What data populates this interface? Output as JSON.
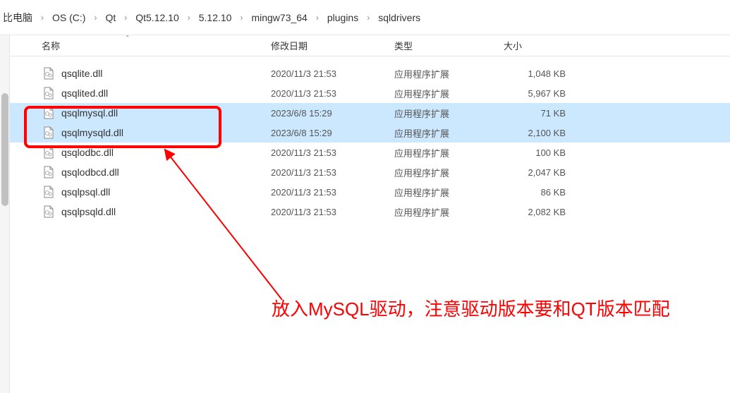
{
  "breadcrumb": {
    "items": [
      {
        "label": "比电脑"
      },
      {
        "label": "OS (C:)"
      },
      {
        "label": "Qt"
      },
      {
        "label": "Qt5.12.10"
      },
      {
        "label": "5.12.10"
      },
      {
        "label": "mingw73_64"
      },
      {
        "label": "plugins"
      },
      {
        "label": "sqldrivers"
      }
    ],
    "separator": "›"
  },
  "columns": {
    "name": "名称",
    "date": "修改日期",
    "type": "类型",
    "size": "大小",
    "sort_indicator": "ˆ"
  },
  "files": [
    {
      "name": "qsqlite.dll",
      "date": "2020/11/3 21:53",
      "type": "应用程序扩展",
      "size": "1,048 KB",
      "selected": false
    },
    {
      "name": "qsqlited.dll",
      "date": "2020/11/3 21:53",
      "type": "应用程序扩展",
      "size": "5,967 KB",
      "selected": false
    },
    {
      "name": "qsqlmysql.dll",
      "date": "2023/6/8 15:29",
      "type": "应用程序扩展",
      "size": "71 KB",
      "selected": true
    },
    {
      "name": "qsqlmysqld.dll",
      "date": "2023/6/8 15:29",
      "type": "应用程序扩展",
      "size": "2,100 KB",
      "selected": true
    },
    {
      "name": "qsqlodbc.dll",
      "date": "2020/11/3 21:53",
      "type": "应用程序扩展",
      "size": "100 KB",
      "selected": false
    },
    {
      "name": "qsqlodbcd.dll",
      "date": "2020/11/3 21:53",
      "type": "应用程序扩展",
      "size": "2,047 KB",
      "selected": false
    },
    {
      "name": "qsqlpsql.dll",
      "date": "2020/11/3 21:53",
      "type": "应用程序扩展",
      "size": "86 KB",
      "selected": false
    },
    {
      "name": "qsqlpsqld.dll",
      "date": "2020/11/3 21:53",
      "type": "应用程序扩展",
      "size": "2,082 KB",
      "selected": false
    }
  ],
  "annotation": {
    "text": "放入MySQL驱动，注意驱动版本要和QT版本匹配"
  }
}
